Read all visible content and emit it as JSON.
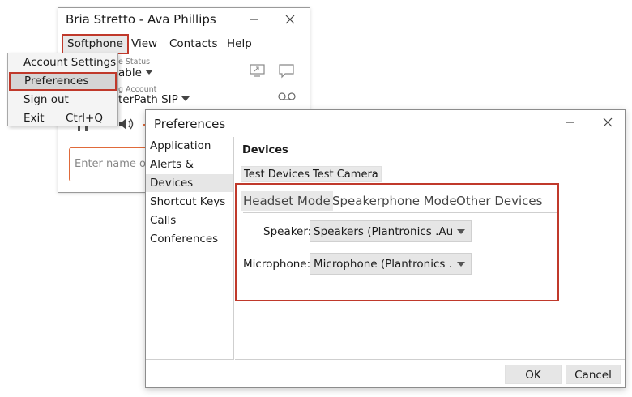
{
  "main_window": {
    "title": "Bria Stretto - Ava Phillips",
    "menu": {
      "softphone": "Softphone",
      "view": "View",
      "contacts": "Contacts",
      "help": "Help"
    },
    "presence_label": "e Status",
    "presence_value": "able",
    "account_label": "g Account",
    "account_value": "terPath SIP",
    "search_placeholder": "Enter name or"
  },
  "dropdown": {
    "items": [
      "Account Settings",
      "Preferences",
      "Sign out",
      "Exit"
    ],
    "exit_shortcut": "Ctrl+Q"
  },
  "preferences": {
    "title": "Preferences",
    "nav": [
      "Application",
      "Alerts & Sounds",
      "Devices",
      "Shortcut Keys",
      "Calls",
      "Conferences"
    ],
    "selected_nav": "Devices",
    "heading": "Devices",
    "test_buttons": [
      "Test Devices",
      "Test Camera"
    ],
    "mode_tabs": [
      "Headset Mode",
      "Speakerphone Mode",
      "Other Devices"
    ],
    "speaker_label": "Speaker:",
    "speaker_value": "Speakers (Plantronics .Aud...",
    "microphone_label": "Microphone:",
    "microphone_value": "Microphone (Plantronics ....",
    "ok": "OK",
    "cancel": "Cancel"
  },
  "colors": {
    "highlight": "#c0392b",
    "search_border": "#e06a3a"
  }
}
